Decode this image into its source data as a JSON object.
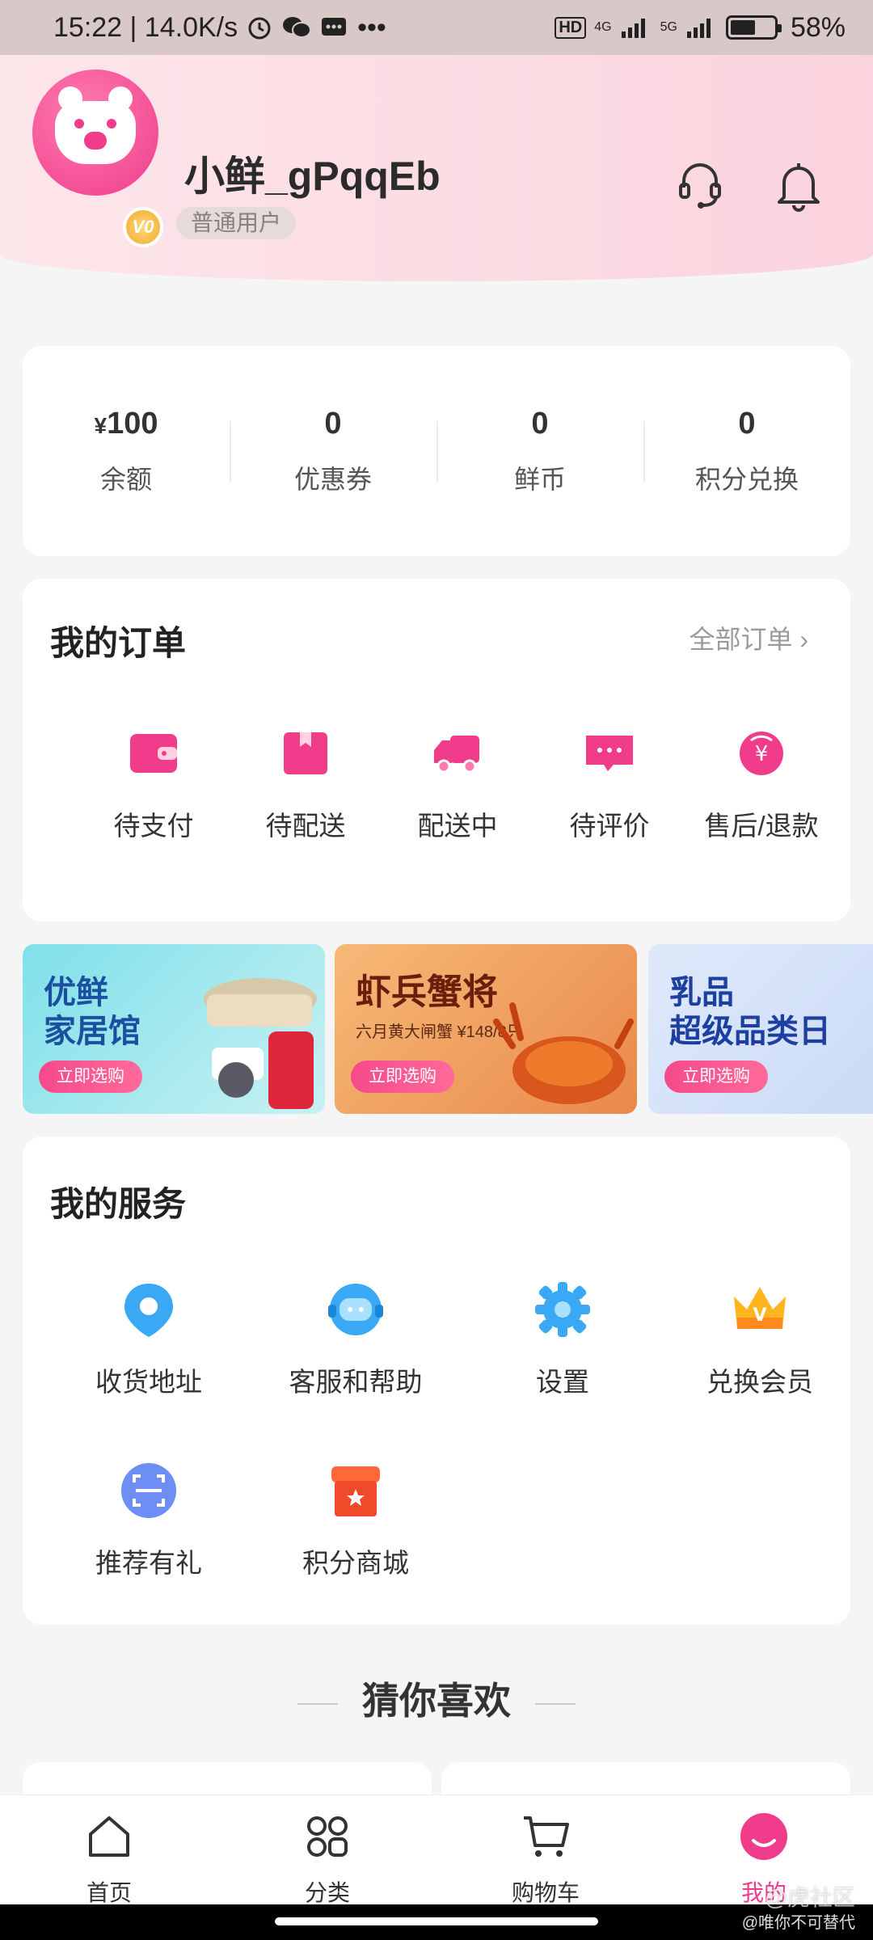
{
  "status_bar": {
    "time_speed": "15:22 | 14.0K/s",
    "net1": "4G",
    "net2": "5G",
    "battery": "58%",
    "battery_level": 0.58,
    "hd": "HD"
  },
  "profile": {
    "username": "小鲜_gPqqEb",
    "level": "普通用户",
    "vip_badge": "V0"
  },
  "assets": [
    {
      "currency": "¥",
      "value": "100",
      "label": "余额"
    },
    {
      "currency": "",
      "value": "0",
      "label": "优惠券"
    },
    {
      "currency": "",
      "value": "0",
      "label": "鲜币"
    },
    {
      "currency": "",
      "value": "0",
      "label": "积分兑换"
    }
  ],
  "orders": {
    "title": "我的订单",
    "all_link": "全部订单",
    "items": [
      {
        "label": "待支付",
        "icon": "wallet-icon"
      },
      {
        "label": "待配送",
        "icon": "package-icon"
      },
      {
        "label": "配送中",
        "icon": "delivery-truck-icon"
      },
      {
        "label": "待评价",
        "icon": "comment-icon"
      },
      {
        "label": "售后/退款",
        "icon": "refund-icon"
      }
    ]
  },
  "banners": [
    {
      "line1": "优鲜",
      "line2": "家居馆",
      "sub": "",
      "button": "立即选购"
    },
    {
      "line1": "虾兵蟹将",
      "line2": "",
      "sub": "六月黄大闸蟹 ¥148/8只",
      "button": "立即选购"
    },
    {
      "line1": "乳品",
      "line2": "超级品类日",
      "sub": "",
      "button": "立即选购"
    }
  ],
  "services": {
    "title": "我的服务",
    "items": [
      {
        "label": "收货地址",
        "icon": "location-pin-icon"
      },
      {
        "label": "客服和帮助",
        "icon": "customer-service-icon"
      },
      {
        "label": "设置",
        "icon": "settings-gear-icon"
      },
      {
        "label": "兑换会员",
        "icon": "crown-icon"
      },
      {
        "label": "推荐有礼",
        "icon": "scan-icon"
      },
      {
        "label": "积分商城",
        "icon": "store-icon"
      }
    ]
  },
  "guess_title": "猜你喜欢",
  "tabbar": [
    {
      "label": "首页",
      "icon": "home-icon",
      "active": false
    },
    {
      "label": "分类",
      "icon": "category-grid-icon",
      "active": false
    },
    {
      "label": "购物车",
      "icon": "cart-icon",
      "active": false
    },
    {
      "label": "我的",
      "icon": "profile-face-icon",
      "active": true
    }
  ],
  "watermark": {
    "main": "@虎社区",
    "sub": "@唯你不可替代"
  },
  "colors": {
    "accent": "#f03c8b",
    "header_bg": "#fbdde4"
  }
}
